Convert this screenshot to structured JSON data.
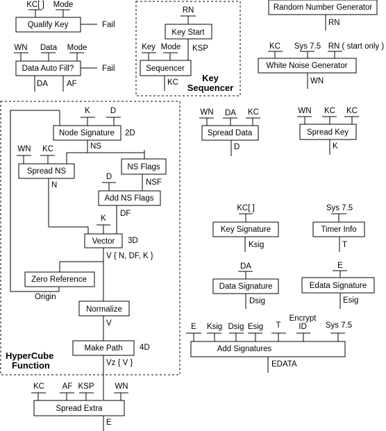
{
  "groups": {
    "key_sequencer": {
      "title_line1": "Key",
      "title_line2": "Sequencer"
    },
    "hypercube": {
      "title_line1": "HyperCube",
      "title_line2": "Function"
    }
  },
  "blocks": {
    "qualify_key": {
      "label": "Qualify Key",
      "inputs": [
        "KC[ ]",
        "Mode"
      ],
      "side_output": "Fail"
    },
    "data_auto_fill": {
      "label": "Data Auto Fill?",
      "inputs": [
        "WN",
        "Data",
        "Mode"
      ],
      "side_output": "Fail",
      "outputs": [
        "DA",
        "AF"
      ]
    },
    "key_start": {
      "label": "Key Start",
      "inputs": [
        "RN"
      ],
      "outputs": [
        "KSP"
      ]
    },
    "sequencer": {
      "label": "Sequencer",
      "inputs": [
        "Key",
        "Mode"
      ],
      "outputs": [
        "KC"
      ]
    },
    "random_number_generator": {
      "label": "Random Number Generator",
      "outputs": [
        "RN"
      ]
    },
    "white_noise_generator": {
      "label": "White Noise Generator",
      "inputs": [
        "KC",
        "Sys 7.5",
        "RN ( start only )"
      ],
      "outputs": [
        "WN"
      ]
    },
    "node_signature": {
      "label": "Node Signature",
      "inputs": [
        "K",
        "D"
      ],
      "tag": "2D",
      "outputs": [
        "NS"
      ]
    },
    "spread_ns": {
      "label": "Spread NS",
      "inputs": [
        "WN",
        "KC"
      ],
      "outputs": [
        "N"
      ]
    },
    "ns_flags": {
      "label": "NS Flags",
      "outputs": [
        "NSF"
      ]
    },
    "add_ns_flags": {
      "label": "Add NS Flags",
      "inputs": [
        "D"
      ],
      "outputs": [
        "DF"
      ]
    },
    "vector": {
      "label": "Vector",
      "inputs": [
        "K"
      ],
      "tag": "3D",
      "outputs": [
        "V { N, DF, K }"
      ]
    },
    "zero_reference": {
      "label": "Zero Reference",
      "outputs": [
        "Origin"
      ]
    },
    "normalize": {
      "label": "Normalize",
      "outputs": [
        "V"
      ]
    },
    "make_path": {
      "label": "Make Path",
      "tag": "4D",
      "outputs": [
        "Vz { V }"
      ]
    },
    "spread_extra": {
      "label": "Spread Extra",
      "inputs": [
        "KC",
        "AF",
        "KSP",
        "WN"
      ],
      "outputs": [
        "E"
      ]
    },
    "spread_data": {
      "label": "Spread Data",
      "inputs": [
        "WN",
        "DA",
        "KC"
      ],
      "outputs": [
        "D"
      ]
    },
    "spread_key": {
      "label": "Spread Key",
      "inputs": [
        "WN",
        "KC",
        "KC"
      ],
      "outputs": [
        "K"
      ]
    },
    "key_signature": {
      "label": "Key Signature",
      "inputs": [
        "KC[ ]"
      ],
      "outputs": [
        "Ksig"
      ]
    },
    "timer_info": {
      "label": "Timer Info",
      "inputs": [
        "Sys 7.5"
      ],
      "outputs": [
        "T"
      ]
    },
    "data_signature": {
      "label": "Data Signature",
      "inputs": [
        "DA"
      ],
      "outputs": [
        "Dsig"
      ]
    },
    "edata_signature": {
      "label": "Edata Signature",
      "inputs": [
        "E"
      ],
      "outputs": [
        "Esig"
      ]
    },
    "add_signatures": {
      "label": "Add Signatures",
      "inputs": [
        "E",
        "Ksig",
        "Dsig",
        "Esig",
        "T",
        "Encrypt",
        "ID",
        "Sys 7.5"
      ],
      "outputs": [
        "EDATA"
      ]
    }
  }
}
